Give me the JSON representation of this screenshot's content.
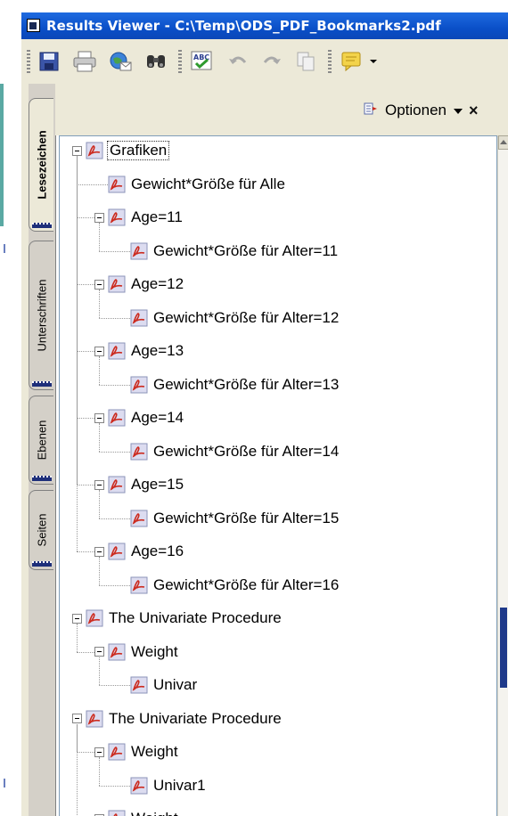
{
  "window": {
    "title": "Results Viewer - C:\\Temp\\ODS_PDF_Bookmarks2.pdf"
  },
  "toolbar": {
    "buttons": [
      {
        "name": "save-icon",
        "label": "Save"
      },
      {
        "name": "print-icon",
        "label": "Print"
      },
      {
        "name": "email-icon",
        "label": "Email"
      },
      {
        "name": "find-icon",
        "label": "Find"
      },
      {
        "name": "spellcheck-icon",
        "label": "Spell check"
      },
      {
        "name": "undo-icon",
        "label": "Undo"
      },
      {
        "name": "redo-icon",
        "label": "Redo"
      },
      {
        "name": "copy-icon",
        "label": "Copy"
      },
      {
        "name": "comment-icon",
        "label": "Comment"
      }
    ]
  },
  "side_tabs": [
    {
      "label": "Lesezeichen",
      "active": true
    },
    {
      "label": "Unterschriften",
      "active": false
    },
    {
      "label": "Ebenen",
      "active": false
    },
    {
      "label": "Seiten",
      "active": false
    }
  ],
  "panel": {
    "options_label": "Optionen",
    "close_label": "×"
  },
  "tree": [
    {
      "label": "Grafiken",
      "level": 0,
      "expanded": true,
      "selected": true
    },
    {
      "label": "Gewicht*Größe für Alle",
      "level": 1
    },
    {
      "label": "Age=11",
      "level": 1,
      "expanded": true
    },
    {
      "label": "Gewicht*Größe für Alter=11",
      "level": 2
    },
    {
      "label": "Age=12",
      "level": 1,
      "expanded": true
    },
    {
      "label": "Gewicht*Größe für Alter=12",
      "level": 2
    },
    {
      "label": "Age=13",
      "level": 1,
      "expanded": true
    },
    {
      "label": "Gewicht*Größe für Alter=13",
      "level": 2
    },
    {
      "label": "Age=14",
      "level": 1,
      "expanded": true
    },
    {
      "label": "Gewicht*Größe für Alter=14",
      "level": 2
    },
    {
      "label": "Age=15",
      "level": 1,
      "expanded": true
    },
    {
      "label": "Gewicht*Größe für Alter=15",
      "level": 2
    },
    {
      "label": "Age=16",
      "level": 1,
      "expanded": true
    },
    {
      "label": "Gewicht*Größe für Alter=16",
      "level": 2
    },
    {
      "label": "The Univariate Procedure",
      "level": 0,
      "expanded": true
    },
    {
      "label": "Weight",
      "level": 1,
      "expanded": true
    },
    {
      "label": "Univar",
      "level": 2
    },
    {
      "label": "The Univariate Procedure",
      "level": 0,
      "expanded": true
    },
    {
      "label": "Weight",
      "level": 1,
      "expanded": true
    },
    {
      "label": "Univar1",
      "level": 2
    },
    {
      "label": "Weight",
      "level": 1,
      "expanded": true
    }
  ],
  "colors": {
    "titlebar": "#0a4fc8",
    "accent_pdf": "#cc2a1e",
    "scroll_thumb": "#1f3a8a"
  }
}
